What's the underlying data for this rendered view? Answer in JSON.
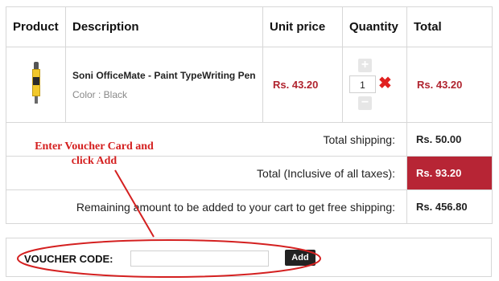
{
  "headers": {
    "product": "Product",
    "description": "Description",
    "unit_price": "Unit price",
    "quantity": "Quantity",
    "total": "Total"
  },
  "item": {
    "image_icon": "pen-icon",
    "name": "Soni OfficeMate - Paint TypeWriting Pen",
    "color": "Color : Black",
    "unit_price": "Rs. 43.20",
    "quantity": "1",
    "total": "Rs. 43.20"
  },
  "summary": {
    "shipping_label": "Total shipping:",
    "shipping_value": "Rs. 50.00",
    "grand_label": "Total (Inclusive of all taxes):",
    "grand_value": "Rs. 93.20",
    "remaining_label": "Remaining amount to be added to your cart to get free shipping:",
    "remaining_value": "Rs. 456.80"
  },
  "voucher": {
    "label": "VOUCHER CODE:",
    "input_value": "",
    "add_label": "Add"
  },
  "annotation": {
    "line1": "Enter Voucher Card and",
    "line2": "click Add"
  },
  "colors": {
    "price": "#b0242f",
    "grand_bg": "#b72535",
    "annotation": "#d42020"
  }
}
